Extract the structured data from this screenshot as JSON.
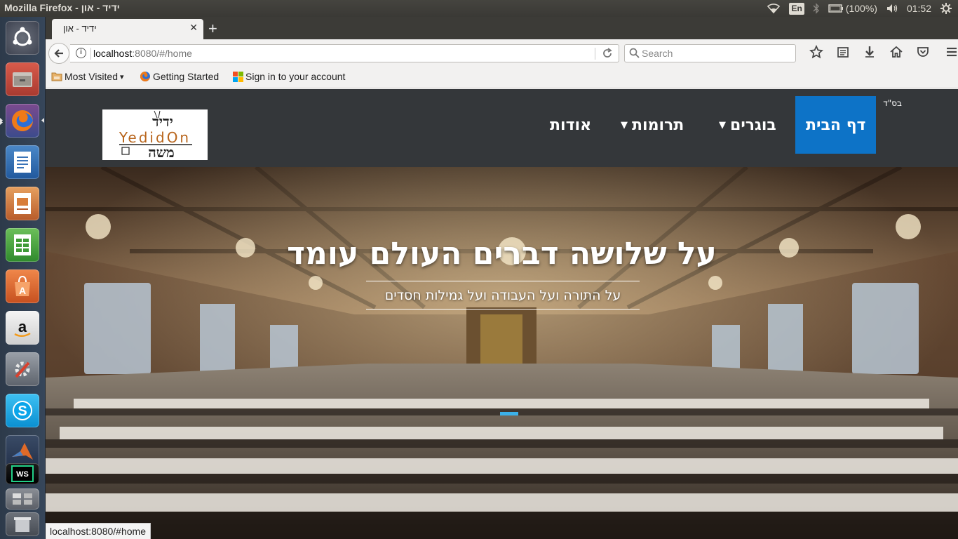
{
  "system": {
    "window_title": "Mozilla Firefox - ידיד - און",
    "keyboard_layout": "En",
    "battery": "(100%)",
    "clock": "01:52"
  },
  "launcher": {
    "items": [
      "ubuntu-dash",
      "files",
      "firefox",
      "writer",
      "impress",
      "calc",
      "software-center",
      "amazon",
      "system-settings",
      "skype",
      "matlab",
      "webstorm",
      "workspaces",
      "trash"
    ]
  },
  "browser": {
    "tab_title": "ידיד - און",
    "url_host": "localhost",
    "url_rest": ":8080/#/home",
    "search_placeholder": "Search",
    "bookmarks": {
      "most_visited": "Most Visited",
      "getting_started": "Getting Started",
      "sign_in": "Sign in to your account"
    },
    "status_url": "localhost:8080/#home"
  },
  "site": {
    "bsd": "בס\"ד",
    "logo_text": "YedidOn",
    "logo_hebrew_top": "ידיד",
    "logo_hebrew_bottom": "משה",
    "nav": {
      "home": "דף הבית",
      "graduates": "בוגרים",
      "donations": "תרומות",
      "about": "אודות"
    },
    "hero": {
      "headline": "על שלושה דברים העולם עומד",
      "subline": "על התורה ועל העבודה ועל גמילות חסדים"
    },
    "colors": {
      "nav_bg": "#34373a",
      "active_bg": "#0d73c7",
      "indicator": "#3bb0e8"
    }
  }
}
